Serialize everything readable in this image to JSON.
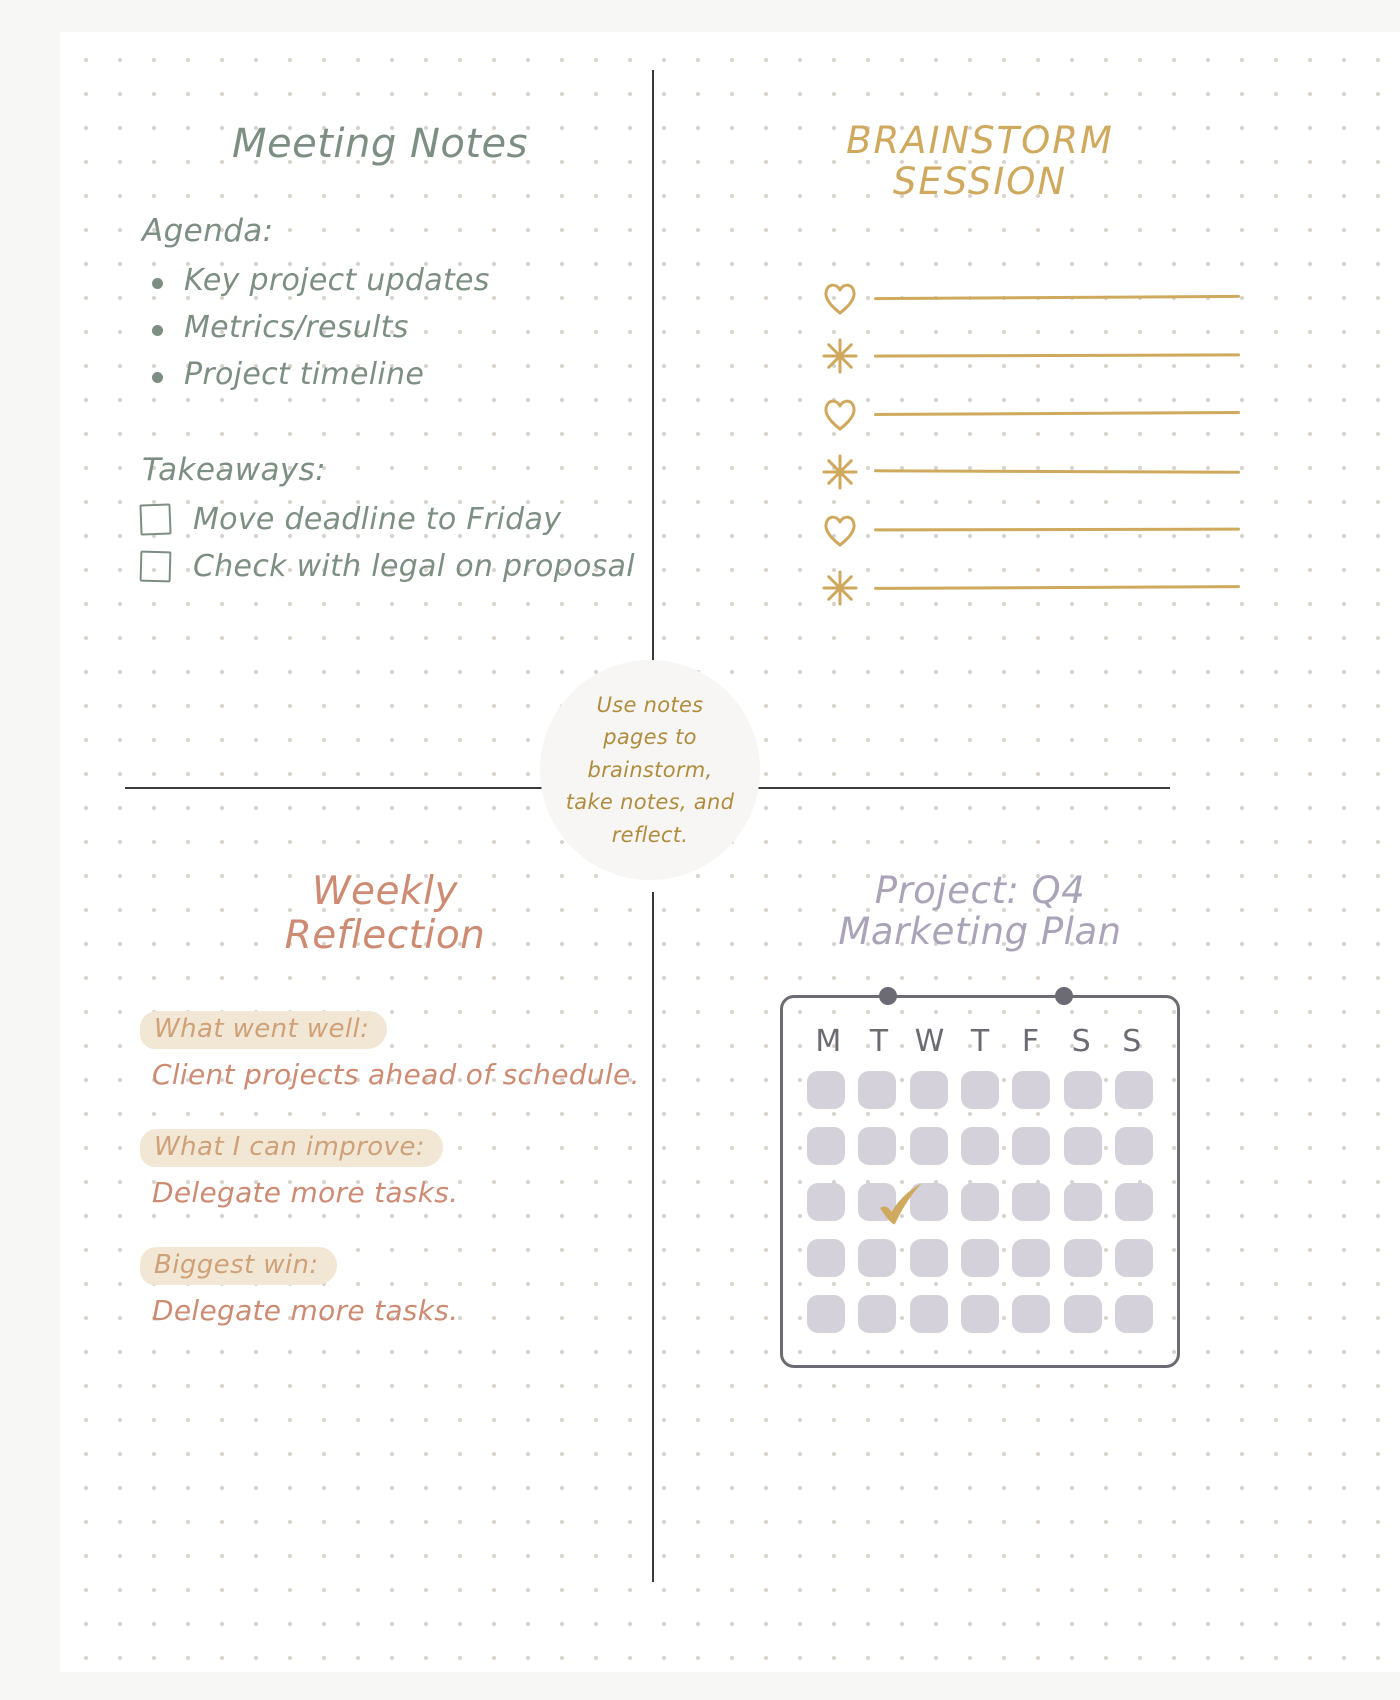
{
  "page": {
    "title": "Notes & Reflection Planner Page"
  },
  "center_badge": {
    "text": "Use notes pages to brainstorm, take notes, and reflect.",
    "color": "#b08c3e"
  },
  "meeting_notes": {
    "title": "Meeting Notes",
    "color": "#7d8f82",
    "agenda_label": "Agenda:",
    "agenda_items": [
      "Key project updates",
      "Metrics/results",
      "Project timeline"
    ],
    "takeaways_label": "Takeaways:",
    "takeaways": [
      {
        "text": "Move deadline to Friday",
        "checked": false
      },
      {
        "text": "Check with legal on proposal",
        "checked": false
      }
    ]
  },
  "brainstorm": {
    "title": "BRAINSTORM SESSION",
    "color": "#cfa95e",
    "rows": [
      {
        "icon": "heart-icon",
        "value": ""
      },
      {
        "icon": "sparkle-icon",
        "value": ""
      },
      {
        "icon": "heart-icon",
        "value": ""
      },
      {
        "icon": "sparkle-icon",
        "value": ""
      },
      {
        "icon": "heart-icon",
        "value": ""
      },
      {
        "icon": "sparkle-icon",
        "value": ""
      }
    ]
  },
  "weekly_reflection": {
    "title": "Weekly Reflection",
    "color": "#cc8b72",
    "highlight_color": "#f2e7d4",
    "blocks": [
      {
        "label": "What went well:",
        "value": "Client projects ahead of schedule."
      },
      {
        "label": "What I can improve:",
        "value": "Delegate more tasks."
      },
      {
        "label": "Biggest win:",
        "value": "Delegate more tasks."
      }
    ]
  },
  "project": {
    "title": "Project: Q4 Marketing Plan",
    "color": "#aba3b8",
    "calendar": {
      "day_labels": [
        "M",
        "T",
        "W",
        "T",
        "F",
        "S",
        "S"
      ],
      "rows": 5,
      "columns": 7,
      "cell_color": "#d4d1da",
      "checked_cell": {
        "row": 3,
        "column": 2,
        "mark": "check-icon",
        "color": "#cfa95e"
      }
    }
  }
}
